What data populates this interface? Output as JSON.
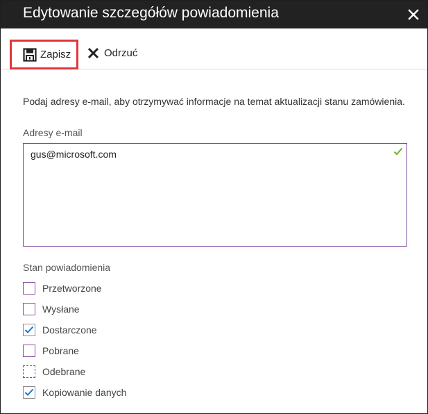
{
  "dialog": {
    "title": "Edytowanie szczegółów powiadomienia",
    "close_icon": "close-icon"
  },
  "toolbar": {
    "save_label": "Zapisz",
    "save_icon": "save-icon",
    "discard_label": "Odrzuć",
    "discard_icon": "discard-icon",
    "highlight_color": "#e0353b"
  },
  "form": {
    "instructions": "Podaj adresy e-mail, aby otrzymywać informacje na temat aktualizacji stanu zamówienia.",
    "email_label": "Adresy e-mail",
    "email_value": "gus@microsoft.com",
    "email_valid": true,
    "status_label": "Stan powiadomienia",
    "statuses": [
      {
        "label": "Przetworzone",
        "checked": false
      },
      {
        "label": "Wysłane",
        "checked": false
      },
      {
        "label": "Dostarczone",
        "checked": true
      },
      {
        "label": "Pobrane",
        "checked": false
      },
      {
        "label": "Odebrane",
        "checked": false
      },
      {
        "label": "Kopiowanie danych",
        "checked": true
      }
    ]
  },
  "colors": {
    "titlebar": "#222222",
    "input_border": "#7d4a9f",
    "valid_check": "#6fae1f",
    "checkmark": "#1a73c9"
  }
}
